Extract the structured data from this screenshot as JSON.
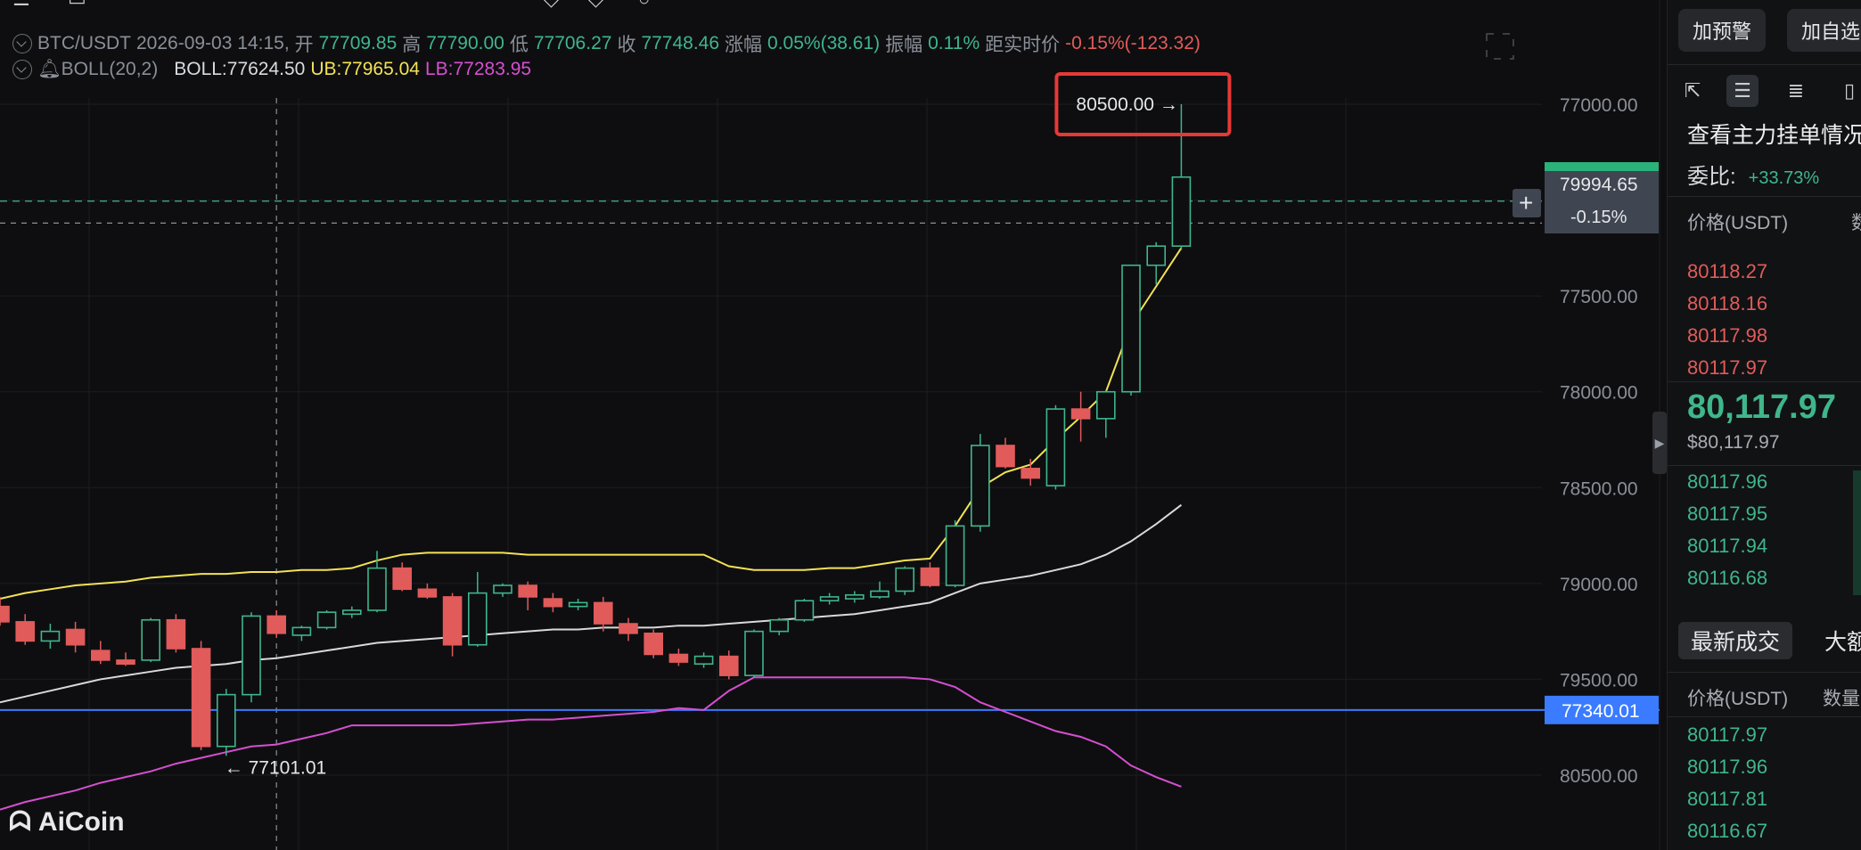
{
  "header": {
    "pair": "BTC/USDT",
    "datetime": "2026-09-03 14:15",
    "open_label": "开",
    "open": "77709.85",
    "high_label": "高",
    "high": "77790.00",
    "low_label": "低",
    "low": "77706.27",
    "close_label": "收",
    "close": "77748.46",
    "change_label": "涨幅",
    "change": "0.05%(38.61)",
    "amp_label": "振幅",
    "amp": "0.11%",
    "dist_label": "距实时价",
    "dist": "-0.15%(-123.32)"
  },
  "indicator": {
    "name": "BOLL(20,2)",
    "boll_label": "BOLL:77624.50",
    "ub_label": "UB:77965.04",
    "lb_label": "LB:77283.95"
  },
  "price_axis": {
    "ticks": [
      "80500.00",
      "79500.00",
      "79000.00",
      "78500.00",
      "78000.00",
      "77500.00",
      "77000.00"
    ],
    "current_price_tag": "79994.65",
    "current_pct_tag": "-0.15%",
    "hline_tag": "77340.01"
  },
  "annotations": {
    "high_marker": "80500.00 →",
    "low_marker": "← 77101.01"
  },
  "brand": {
    "name": "AiCoin"
  },
  "colors": {
    "up": "#3fb68b",
    "down": "#e15b5b",
    "boll_mid": "#d9d9d9",
    "boll_ub": "#f3e255",
    "boll_lb": "#d64fd0",
    "hline": "#3a7bff",
    "highlight": "#e53935"
  },
  "right_panel": {
    "btn_alert": "加预警",
    "btn_watch": "加自选",
    "title": "查看主力挂单情况",
    "ratio_label": "委比:",
    "ratio_value": "+33.73%",
    "book_head_price": "价格(USDT)",
    "book_head_qty": "数",
    "asks": [
      "80118.27",
      "80118.16",
      "80117.98",
      "80117.97"
    ],
    "last_price": "80,117.97",
    "last_usd": "$80,117.97",
    "bids": [
      "80117.96",
      "80117.95",
      "80117.94",
      "80116.68"
    ],
    "trades_tab_active": "最新成交",
    "trades_tab_other": "大额",
    "trades_head_price": "价格(USDT)",
    "trades_head_qty": "数量",
    "trades": [
      "80117.97",
      "80117.96",
      "80117.81",
      "80116.67"
    ]
  },
  "chart_data": {
    "type": "candlestick",
    "title": "BTC/USDT",
    "ylim": [
      76800,
      80700
    ],
    "y_ticks": [
      77000,
      77500,
      78000,
      78500,
      79000,
      79500,
      80500
    ],
    "candles": [
      {
        "o": 77880,
        "h": 77930,
        "l": 77780,
        "c": 77800
      },
      {
        "o": 77800,
        "h": 77840,
        "l": 77680,
        "c": 77700
      },
      {
        "o": 77700,
        "h": 77790,
        "l": 77660,
        "c": 77750
      },
      {
        "o": 77760,
        "h": 77800,
        "l": 77640,
        "c": 77680
      },
      {
        "o": 77650,
        "h": 77700,
        "l": 77580,
        "c": 77600
      },
      {
        "o": 77600,
        "h": 77640,
        "l": 77570,
        "c": 77580
      },
      {
        "o": 77600,
        "h": 77820,
        "l": 77590,
        "c": 77810
      },
      {
        "o": 77810,
        "h": 77840,
        "l": 77640,
        "c": 77660
      },
      {
        "o": 77660,
        "h": 77700,
        "l": 77130,
        "c": 77150
      },
      {
        "o": 77150,
        "h": 77450,
        "l": 77101.01,
        "c": 77420
      },
      {
        "o": 77420,
        "h": 77850,
        "l": 77380,
        "c": 77830
      },
      {
        "o": 77830,
        "h": 77860,
        "l": 77720,
        "c": 77740
      },
      {
        "o": 77730,
        "h": 77780,
        "l": 77700,
        "c": 77770
      },
      {
        "o": 77770,
        "h": 77860,
        "l": 77760,
        "c": 77850
      },
      {
        "o": 77840,
        "h": 77880,
        "l": 77820,
        "c": 77860
      },
      {
        "o": 77860,
        "h": 78170,
        "l": 77850,
        "c": 78080
      },
      {
        "o": 78080,
        "h": 78110,
        "l": 77960,
        "c": 77970
      },
      {
        "o": 77970,
        "h": 78000,
        "l": 77920,
        "c": 77930
      },
      {
        "o": 77930,
        "h": 77950,
        "l": 77620,
        "c": 77680
      },
      {
        "o": 77680,
        "h": 78060,
        "l": 77670,
        "c": 77950
      },
      {
        "o": 77950,
        "h": 78000,
        "l": 77930,
        "c": 77990
      },
      {
        "o": 77990,
        "h": 78010,
        "l": 77860,
        "c": 77930
      },
      {
        "o": 77920,
        "h": 77950,
        "l": 77850,
        "c": 77880
      },
      {
        "o": 77880,
        "h": 77920,
        "l": 77860,
        "c": 77900
      },
      {
        "o": 77900,
        "h": 77930,
        "l": 77750,
        "c": 77790
      },
      {
        "o": 77790,
        "h": 77820,
        "l": 77700,
        "c": 77740
      },
      {
        "o": 77740,
        "h": 77760,
        "l": 77610,
        "c": 77630
      },
      {
        "o": 77630,
        "h": 77660,
        "l": 77570,
        "c": 77590
      },
      {
        "o": 77580,
        "h": 77640,
        "l": 77560,
        "c": 77620
      },
      {
        "o": 77620,
        "h": 77650,
        "l": 77500,
        "c": 77520
      },
      {
        "o": 77520,
        "h": 77760,
        "l": 77510,
        "c": 77750
      },
      {
        "o": 77750,
        "h": 77820,
        "l": 77730,
        "c": 77810
      },
      {
        "o": 77810,
        "h": 77920,
        "l": 77800,
        "c": 77910
      },
      {
        "o": 77910,
        "h": 77950,
        "l": 77890,
        "c": 77930
      },
      {
        "o": 77920,
        "h": 77960,
        "l": 77900,
        "c": 77940
      },
      {
        "o": 77930,
        "h": 78010,
        "l": 77920,
        "c": 77960
      },
      {
        "o": 77960,
        "h": 78090,
        "l": 77940,
        "c": 78080
      },
      {
        "o": 78080,
        "h": 78110,
        "l": 77980,
        "c": 77990
      },
      {
        "o": 77990,
        "h": 78330,
        "l": 77980,
        "c": 78300
      },
      {
        "o": 78300,
        "h": 78780,
        "l": 78270,
        "c": 78720
      },
      {
        "o": 78720,
        "h": 78760,
        "l": 78600,
        "c": 78610
      },
      {
        "o": 78600,
        "h": 78650,
        "l": 78510,
        "c": 78550
      },
      {
        "o": 78510,
        "h": 78930,
        "l": 78490,
        "c": 78910
      },
      {
        "o": 78910,
        "h": 79000,
        "l": 78740,
        "c": 78860
      },
      {
        "o": 78860,
        "h": 79010,
        "l": 78760,
        "c": 79000
      },
      {
        "o": 79000,
        "h": 79660,
        "l": 78980,
        "c": 79660
      },
      {
        "o": 79660,
        "h": 79780,
        "l": 79560,
        "c": 79760
      },
      {
        "o": 79760,
        "h": 80500,
        "l": 79740,
        "c": 80120
      }
    ],
    "boll_mid": [
      77380,
      77410,
      77440,
      77470,
      77500,
      77520,
      77540,
      77560,
      77570,
      77580,
      77600,
      77610,
      77630,
      77650,
      77670,
      77690,
      77700,
      77710,
      77720,
      77730,
      77740,
      77750,
      77760,
      77760,
      77770,
      77770,
      77770,
      77780,
      77780,
      77790,
      77800,
      77810,
      77820,
      77830,
      77840,
      77860,
      77880,
      77900,
      77950,
      78000,
      78020,
      78040,
      78070,
      78100,
      78150,
      78220,
      78310,
      78410
    ],
    "boll_ub": [
      77920,
      77950,
      77970,
      77990,
      78000,
      78010,
      78030,
      78040,
      78050,
      78050,
      78060,
      78060,
      78070,
      78070,
      78080,
      78120,
      78150,
      78160,
      78160,
      78160,
      78160,
      78150,
      78150,
      78150,
      78150,
      78150,
      78150,
      78150,
      78150,
      78090,
      78070,
      78070,
      78070,
      78080,
      78080,
      78100,
      78120,
      78130,
      78300,
      78500,
      78580,
      78620,
      78750,
      78870,
      79000,
      79350,
      79550,
      79750
    ],
    "boll_lb": [
      76820,
      76860,
      76890,
      76920,
      76960,
      76990,
      77020,
      77060,
      77090,
      77120,
      77150,
      77160,
      77190,
      77220,
      77260,
      77260,
      77260,
      77260,
      77260,
      77270,
      77280,
      77290,
      77290,
      77300,
      77310,
      77320,
      77330,
      77350,
      77340,
      77440,
      77510,
      77510,
      77510,
      77510,
      77510,
      77510,
      77510,
      77500,
      77460,
      77380,
      77330,
      77280,
      77230,
      77200,
      77150,
      77050,
      76990,
      76940
    ],
    "hline": 77340.01,
    "current_price": 79994.65,
    "crosshair_price": 79880,
    "crosshair_candle": 11,
    "max_marker": 80500.0,
    "min_marker": 77101.01
  }
}
